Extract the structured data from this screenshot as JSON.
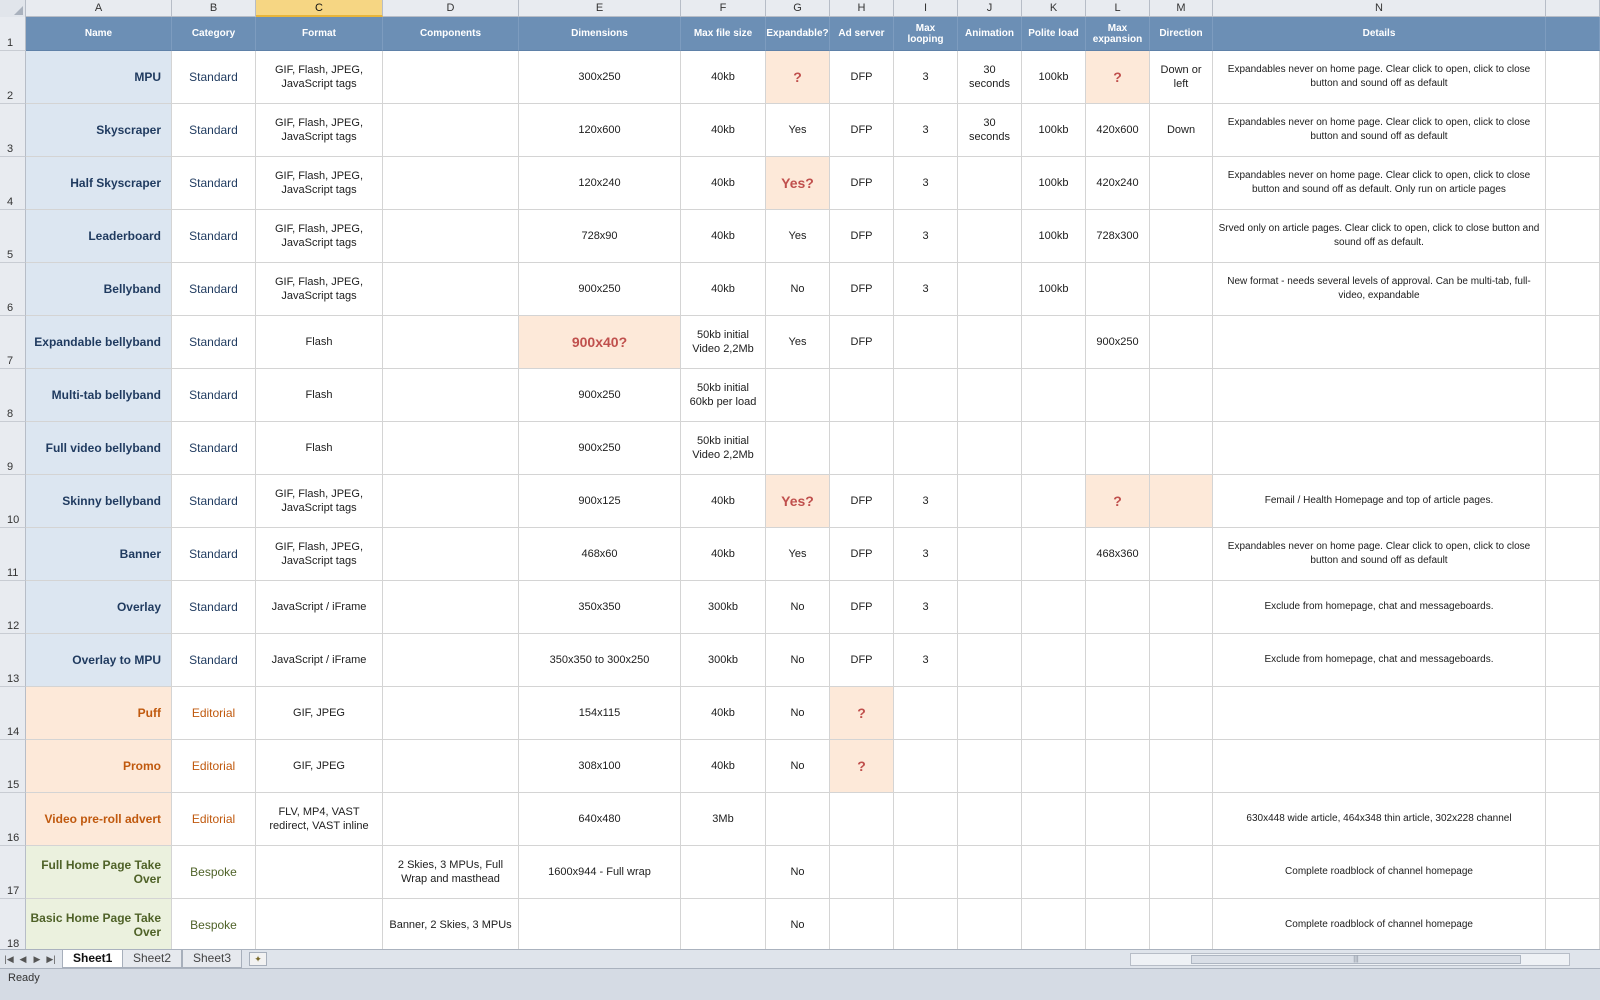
{
  "columns": [
    "A",
    "B",
    "C",
    "D",
    "E",
    "F",
    "G",
    "H",
    "I",
    "J",
    "K",
    "L",
    "M",
    "N"
  ],
  "active_column": "C",
  "row_numbers": [
    "1",
    "2",
    "3",
    "4",
    "5",
    "6",
    "7",
    "8",
    "9",
    "10",
    "11",
    "12",
    "13",
    "14",
    "15",
    "16",
    "17",
    "18"
  ],
  "headers": [
    "Name",
    "Category",
    "Format",
    "Components",
    "Dimensions",
    "Max file size",
    "Expandable?",
    "Ad server",
    "Max looping",
    "Animation",
    "Polite load",
    "Max expansion",
    "Direction",
    "Details"
  ],
  "rows": [
    {
      "group": "std",
      "name": "MPU",
      "category": "Standard",
      "format": "GIF, Flash, JPEG, JavaScript tags",
      "components": "",
      "dimensions": "300x250",
      "max_file_size": "40kb",
      "expandable": "?",
      "ad_server": "DFP",
      "max_looping": "3",
      "animation": "30 seconds",
      "polite_load": "100kb",
      "max_expansion": "?",
      "direction": "Down or left",
      "details": "Expandables never on home page. Clear click to open, click to close button and sound off as default"
    },
    {
      "group": "std",
      "name": "Skyscraper",
      "category": "Standard",
      "format": "GIF, Flash, JPEG, JavaScript tags",
      "components": "",
      "dimensions": "120x600",
      "max_file_size": "40kb",
      "expandable": "Yes",
      "ad_server": "DFP",
      "max_looping": "3",
      "animation": "30 seconds",
      "polite_load": "100kb",
      "max_expansion": "420x600",
      "direction": "Down",
      "details": "Expandables never on home page. Clear click to open, click to close button and sound off as default"
    },
    {
      "group": "std",
      "name": "Half Skyscraper",
      "category": "Standard",
      "format": "GIF, Flash, JPEG, JavaScript tags",
      "components": "",
      "dimensions": "120x240",
      "max_file_size": "40kb",
      "expandable": "Yes?",
      "ad_server": "DFP",
      "max_looping": "3",
      "animation": "",
      "polite_load": "100kb",
      "max_expansion": "420x240",
      "direction": "",
      "details": "Expandables never on home page. Clear click to open, click to close button and sound off as default. Only run on article pages"
    },
    {
      "group": "std",
      "name": "Leaderboard",
      "category": "Standard",
      "format": "GIF, Flash, JPEG, JavaScript tags",
      "components": "",
      "dimensions": "728x90",
      "max_file_size": "40kb",
      "expandable": "Yes",
      "ad_server": "DFP",
      "max_looping": "3",
      "animation": "",
      "polite_load": "100kb",
      "max_expansion": "728x300",
      "direction": "",
      "details": "Srved only on article pages. Clear click to open, click to close button and sound off as default."
    },
    {
      "group": "std",
      "name": "Bellyband",
      "category": "Standard",
      "format": "GIF, Flash, JPEG, JavaScript tags",
      "components": "",
      "dimensions": "900x250",
      "max_file_size": "40kb",
      "expandable": "No",
      "ad_server": "DFP",
      "max_looping": "3",
      "animation": "",
      "polite_load": "100kb",
      "max_expansion": "",
      "direction": "",
      "details": "New format - needs several levels of approval. Can be multi-tab, full-video, expandable"
    },
    {
      "group": "std",
      "name": "Expandable bellyband",
      "category": "Standard",
      "format": "Flash",
      "components": "",
      "dimensions": "900x40?",
      "max_file_size": "50kb initial Video 2,2Mb",
      "expandable": "Yes",
      "ad_server": "DFP",
      "max_looping": "",
      "animation": "",
      "polite_load": "",
      "max_expansion": "900x250",
      "direction": "",
      "details": ""
    },
    {
      "group": "std",
      "name": "Multi-tab bellyband",
      "category": "Standard",
      "format": "Flash",
      "components": "",
      "dimensions": "900x250",
      "max_file_size": "50kb initial 60kb per load",
      "expandable": "",
      "ad_server": "",
      "max_looping": "",
      "animation": "",
      "polite_load": "",
      "max_expansion": "",
      "direction": "",
      "details": ""
    },
    {
      "group": "std",
      "name": "Full video bellyband",
      "category": "Standard",
      "format": "Flash",
      "components": "",
      "dimensions": "900x250",
      "max_file_size": "50kb initial Video 2,2Mb",
      "expandable": "",
      "ad_server": "",
      "max_looping": "",
      "animation": "",
      "polite_load": "",
      "max_expansion": "",
      "direction": "",
      "details": ""
    },
    {
      "group": "std",
      "name": "Skinny bellyband",
      "category": "Standard",
      "format": "GIF, Flash, JPEG, JavaScript tags",
      "components": "",
      "dimensions": "900x125",
      "max_file_size": "40kb",
      "expandable": "Yes?",
      "ad_server": "DFP",
      "max_looping": "3",
      "animation": "",
      "polite_load": "",
      "max_expansion": "?",
      "direction": "",
      "details": "Femail / Health Homepage and top of article pages."
    },
    {
      "group": "std",
      "name": "Banner",
      "category": "Standard",
      "format": "GIF, Flash, JPEG, JavaScript tags",
      "components": "",
      "dimensions": "468x60",
      "max_file_size": "40kb",
      "expandable": "Yes",
      "ad_server": "DFP",
      "max_looping": "3",
      "animation": "",
      "polite_load": "",
      "max_expansion": "468x360",
      "direction": "",
      "details": "Expandables never on home page. Clear click to open, click to close button and sound off as default"
    },
    {
      "group": "std",
      "name": "Overlay",
      "category": "Standard",
      "format": "JavaScript / iFrame",
      "components": "",
      "dimensions": "350x350",
      "max_file_size": "300kb",
      "expandable": "No",
      "ad_server": "DFP",
      "max_looping": "3",
      "animation": "",
      "polite_load": "",
      "max_expansion": "",
      "direction": "",
      "details": "Exclude from homepage, chat and messageboards."
    },
    {
      "group": "std",
      "name": "Overlay to MPU",
      "category": "Standard",
      "format": "JavaScript / iFrame",
      "components": "",
      "dimensions": "350x350 to 300x250",
      "max_file_size": "300kb",
      "expandable": "No",
      "ad_server": "DFP",
      "max_looping": "3",
      "animation": "",
      "polite_load": "",
      "max_expansion": "",
      "direction": "",
      "details": "Exclude from homepage, chat and messageboards."
    },
    {
      "group": "edt",
      "name": "Puff",
      "category": "Editorial",
      "format": "GIF, JPEG",
      "components": "",
      "dimensions": "154x115",
      "max_file_size": "40kb",
      "expandable": "No",
      "ad_server": "?",
      "max_looping": "",
      "animation": "",
      "polite_load": "",
      "max_expansion": "",
      "direction": "",
      "details": ""
    },
    {
      "group": "edt",
      "name": "Promo",
      "category": "Editorial",
      "format": "GIF, JPEG",
      "components": "",
      "dimensions": "308x100",
      "max_file_size": "40kb",
      "expandable": "No",
      "ad_server": "?",
      "max_looping": "",
      "animation": "",
      "polite_load": "",
      "max_expansion": "",
      "direction": "",
      "details": ""
    },
    {
      "group": "edt",
      "name": "Video pre-roll advert",
      "category": "Editorial",
      "format": "FLV, MP4, VAST redirect, VAST inline",
      "components": "",
      "dimensions": "640x480",
      "max_file_size": "3Mb",
      "expandable": "",
      "ad_server": "",
      "max_looping": "",
      "animation": "",
      "polite_load": "",
      "max_expansion": "",
      "direction": "",
      "details": "630x448 wide article, 464x348 thin article, 302x228 channel"
    },
    {
      "group": "bsp",
      "name": "Full Home Page Take Over",
      "category": "Bespoke",
      "format": "",
      "components": "2 Skies, 3 MPUs, Full Wrap and masthead",
      "dimensions": "1600x944 - Full wrap",
      "max_file_size": "",
      "expandable": "No",
      "ad_server": "",
      "max_looping": "",
      "animation": "",
      "polite_load": "",
      "max_expansion": "",
      "direction": "",
      "details": "Complete roadblock of channel homepage"
    },
    {
      "group": "bsp",
      "name": "Basic Home Page Take Over",
      "category": "Bespoke",
      "format": "",
      "components": "Banner, 2 Skies, 3 MPUs",
      "dimensions": "",
      "max_file_size": "",
      "expandable": "No",
      "ad_server": "",
      "max_looping": "",
      "animation": "",
      "polite_load": "",
      "max_expansion": "",
      "direction": "",
      "details": "Complete roadblock of channel homepage"
    }
  ],
  "highlights": [
    {
      "row": 0,
      "col": "expandable"
    },
    {
      "row": 0,
      "col": "max_expansion"
    },
    {
      "row": 2,
      "col": "expandable"
    },
    {
      "row": 5,
      "col": "dimensions"
    },
    {
      "row": 8,
      "col": "expandable"
    },
    {
      "row": 8,
      "col": "max_expansion"
    },
    {
      "row": 8,
      "col": "direction"
    },
    {
      "row": 12,
      "col": "ad_server"
    },
    {
      "row": 13,
      "col": "ad_server"
    }
  ],
  "sheets": [
    "Sheet1",
    "Sheet2",
    "Sheet3"
  ],
  "active_sheet": "Sheet1",
  "status": "Ready",
  "colors": {
    "standard_fill": "#dce6f1",
    "editorial_fill": "#fde9d9",
    "bespoke_fill": "#ebf1de",
    "header_fill": "#6c8fb5",
    "highlight_fill": "#fde9d9",
    "highlight_text": "#c0504d"
  }
}
